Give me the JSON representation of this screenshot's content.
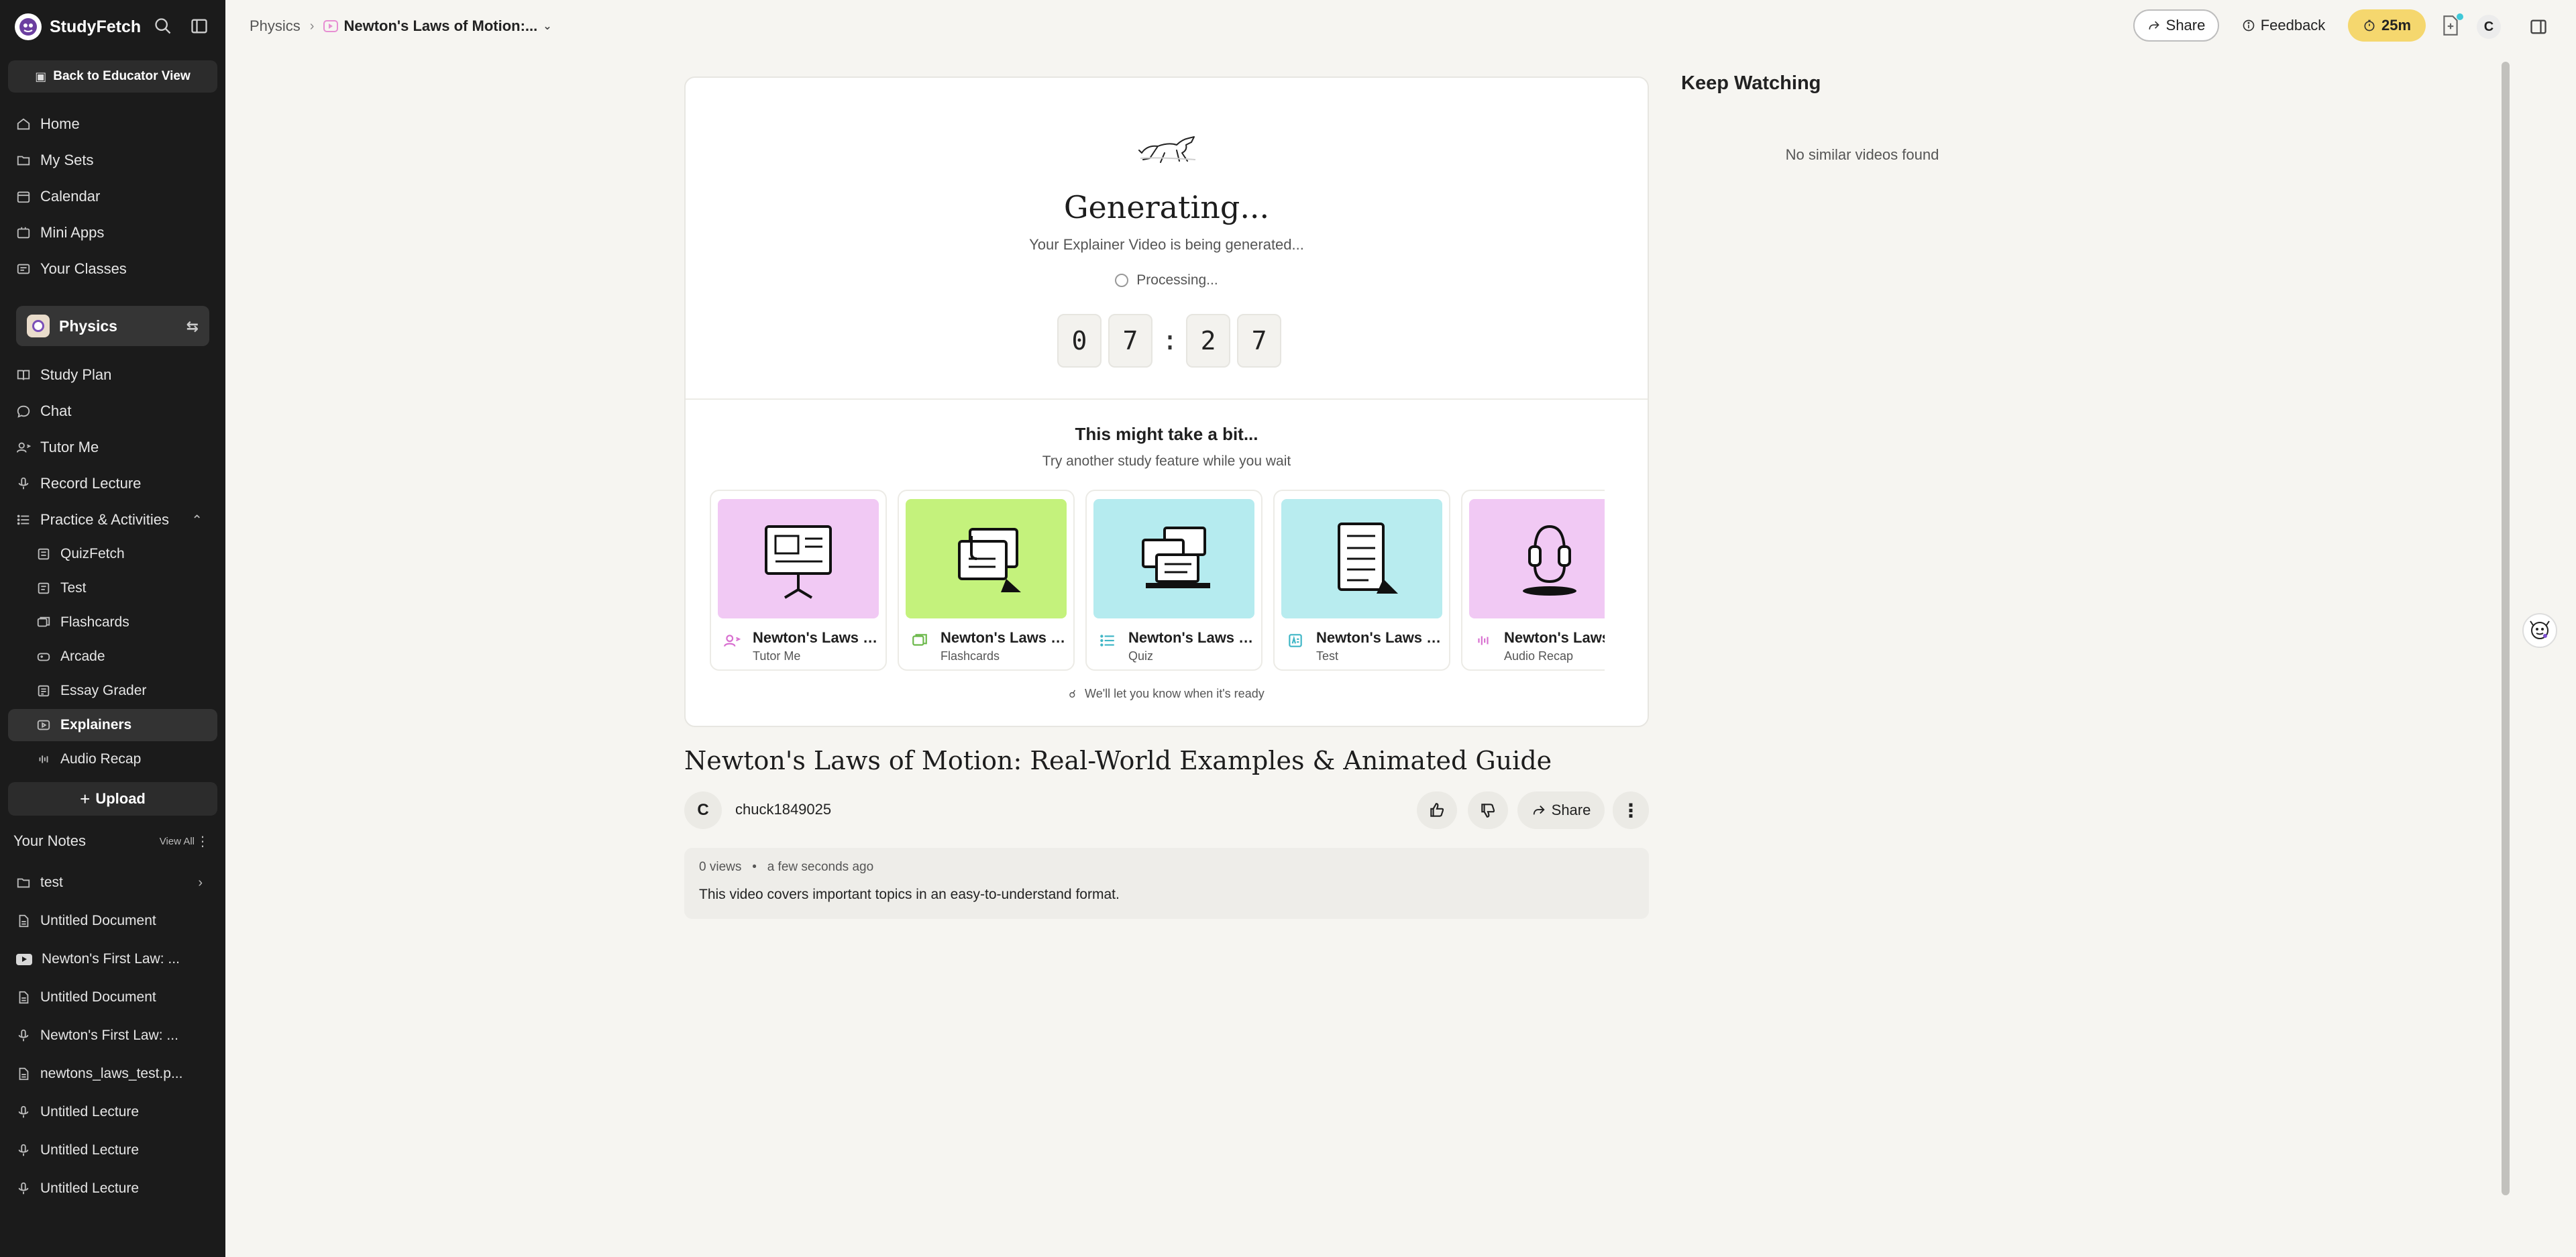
{
  "app": {
    "name": "StudyFetch"
  },
  "sidebar": {
    "educator_button": "Back to Educator View",
    "main_nav": [
      {
        "label": "Home",
        "icon": "home-icon"
      },
      {
        "label": "My Sets",
        "icon": "folder-icon"
      },
      {
        "label": "Calendar",
        "icon": "calendar-icon"
      },
      {
        "label": "Mini Apps",
        "icon": "apps-icon"
      },
      {
        "label": "Your Classes",
        "icon": "classes-icon"
      }
    ],
    "class_name": "Physics",
    "class_nav": [
      {
        "label": "Study Plan",
        "icon": "book-icon"
      },
      {
        "label": "Chat",
        "icon": "chat-icon"
      },
      {
        "label": "Tutor Me",
        "icon": "tutor-icon"
      },
      {
        "label": "Record Lecture",
        "icon": "mic-icon"
      },
      {
        "label": "Practice & Activities",
        "icon": "list-icon"
      }
    ],
    "practice_items": [
      {
        "label": "QuizFetch"
      },
      {
        "label": "Test"
      },
      {
        "label": "Flashcards"
      },
      {
        "label": "Arcade"
      },
      {
        "label": "Essay Grader"
      },
      {
        "label": "Explainers",
        "active": true
      },
      {
        "label": "Audio Recap"
      }
    ],
    "upload_label": "Upload",
    "notes": {
      "title": "Your Notes",
      "view_all": "View All",
      "items": [
        {
          "label": "test",
          "icon": "folder-icon"
        },
        {
          "label": "Untitled Document",
          "icon": "document-icon"
        },
        {
          "label": "Newton's First Law: ...",
          "icon": "youtube-icon"
        },
        {
          "label": "Untitled Document",
          "icon": "document-icon"
        },
        {
          "label": "Newton's First Law: ...",
          "icon": "mic-icon"
        },
        {
          "label": "newtons_laws_test.p...",
          "icon": "document-icon"
        },
        {
          "label": "Untitled Lecture",
          "icon": "mic-icon"
        },
        {
          "label": "Untitled Lecture",
          "icon": "mic-icon"
        },
        {
          "label": "Untitled Lecture",
          "icon": "mic-icon"
        }
      ]
    }
  },
  "header": {
    "breadcrumb_parent": "Physics",
    "breadcrumb_current": "Newton's Laws of Motion:...",
    "share_label": "Share",
    "feedback_label": "Feedback",
    "timer_label": "25m",
    "avatar_initial": "C"
  },
  "generation": {
    "title": "Generating...",
    "subtitle": "Your Explainer Video is being generated...",
    "status": "Processing...",
    "countdown": [
      "0",
      "7",
      "2",
      "7"
    ],
    "wait_title": "This might take a bit...",
    "wait_subtitle": "Try another study feature while you wait",
    "notify": "We'll let you know when it's ready",
    "features": [
      {
        "name": "Newton's Laws of Motion",
        "type": "Tutor Me",
        "bg": "#f1c9f4",
        "icon_color": "#d86fd0",
        "icon": "presentation-icon"
      },
      {
        "name": "Newton's Laws of Motion",
        "type": "Flashcards",
        "bg": "#c4f27c",
        "icon_color": "#6bb84a",
        "icon": "flashcards-icon"
      },
      {
        "name": "Newton's Laws of Motion",
        "type": "Quiz",
        "bg": "#b5ebef",
        "icon_color": "#3fb6c6",
        "icon": "quiz-icon"
      },
      {
        "name": "Newton's Laws of Motion",
        "type": "Test",
        "bg": "#b8ecef",
        "icon_color": "#3fb6c6",
        "icon": "test-icon"
      },
      {
        "name": "Newton's Laws of Motion",
        "type": "Audio Recap",
        "bg": "#f1c9f4",
        "icon_color": "#d86fd0",
        "icon": "headphones-icon"
      }
    ]
  },
  "video": {
    "title": "Newton's Laws of Motion: Real-World Examples & Animated Guide",
    "owner_initial": "C",
    "owner": "chuck1849025",
    "share_label": "Share",
    "views": "0 views",
    "time": "a few seconds ago",
    "description": "This video covers important topics in an easy-to-understand format."
  },
  "right_panel": {
    "title": "Keep Watching",
    "empty": "No similar videos found"
  }
}
